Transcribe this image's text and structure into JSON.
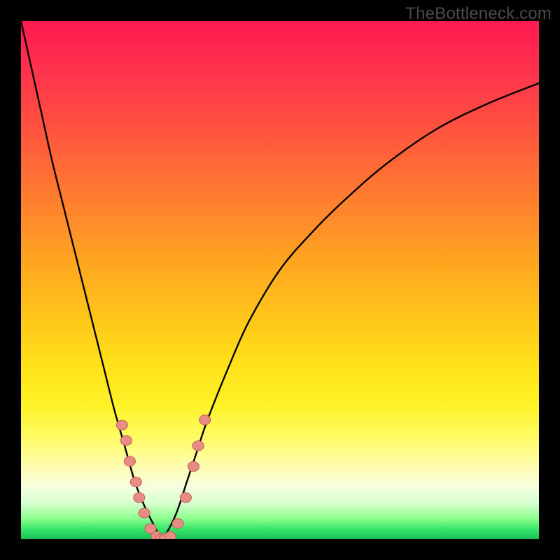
{
  "watermark": "TheBottleneck.com",
  "colors": {
    "curve": "#000000",
    "marker_fill": "#e98b85",
    "marker_stroke": "#c55f58",
    "background_black": "#000000"
  },
  "chart_data": {
    "type": "line",
    "title": "",
    "xlabel": "",
    "ylabel": "",
    "xlim": [
      0,
      100
    ],
    "ylim": [
      0,
      100
    ],
    "grid": false,
    "legend": false,
    "note": "V-shaped bottleneck curve; y is mismatch percentage, 0 at optimum (~x≈27). Curve values are visual estimates (no tick labels on axes).",
    "x": [
      0,
      2,
      4,
      6,
      8,
      10,
      12,
      14,
      16,
      18,
      20,
      22,
      24,
      26,
      27,
      28,
      30,
      32,
      34,
      36,
      40,
      44,
      50,
      56,
      62,
      70,
      80,
      90,
      100
    ],
    "values": [
      100,
      91,
      82,
      73,
      65,
      57,
      49,
      41,
      33,
      25,
      18,
      11,
      6,
      2,
      0,
      1,
      5,
      11,
      17,
      23,
      33,
      42,
      52,
      59,
      65,
      72,
      79,
      84,
      88
    ],
    "markers": {
      "note": "pink dot clusters near the minimum on both branches; positions are approximate",
      "points": [
        {
          "x": 19.5,
          "y": 22
        },
        {
          "x": 20.3,
          "y": 19
        },
        {
          "x": 21.0,
          "y": 15
        },
        {
          "x": 22.2,
          "y": 11
        },
        {
          "x": 22.8,
          "y": 8
        },
        {
          "x": 23.8,
          "y": 5
        },
        {
          "x": 25.0,
          "y": 2
        },
        {
          "x": 26.2,
          "y": 0.5
        },
        {
          "x": 27.0,
          "y": 0
        },
        {
          "x": 27.8,
          "y": 0
        },
        {
          "x": 28.8,
          "y": 0.5
        },
        {
          "x": 30.3,
          "y": 3
        },
        {
          "x": 31.8,
          "y": 8
        },
        {
          "x": 33.3,
          "y": 14
        },
        {
          "x": 34.2,
          "y": 18
        },
        {
          "x": 35.5,
          "y": 23
        }
      ],
      "r": 7
    }
  }
}
